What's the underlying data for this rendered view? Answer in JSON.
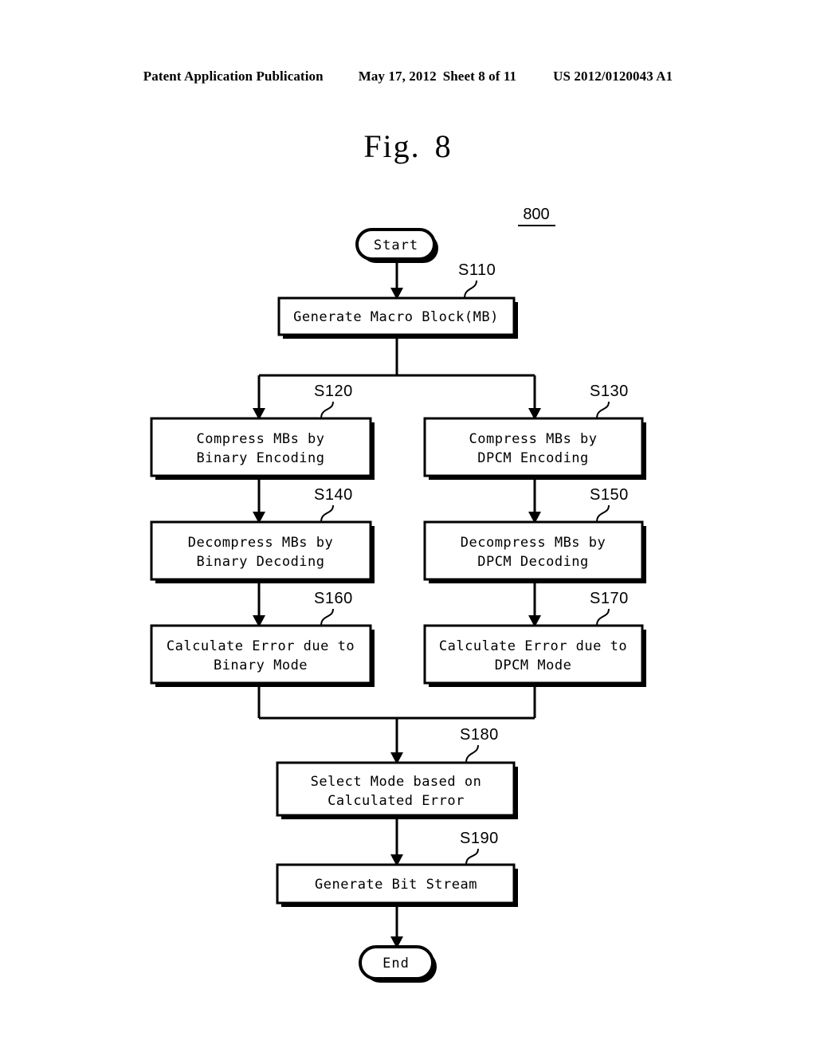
{
  "header": {
    "publication": "Patent Application Publication",
    "date": "May 17, 2012",
    "sheet": "Sheet 8 of 11",
    "publication_number": "US 2012/0120043 A1"
  },
  "figure": {
    "label": "Fig.",
    "number": "8",
    "reference_numeral": "800"
  },
  "flowchart": {
    "start_label": "Start",
    "end_label": "End",
    "nodes": [
      {
        "id": "s110",
        "step": "S110",
        "lines": [
          "Generate Macro Block(MB)"
        ]
      },
      {
        "id": "s120",
        "step": "S120",
        "lines": [
          "Compress MBs by",
          "Binary Encoding"
        ]
      },
      {
        "id": "s130",
        "step": "S130",
        "lines": [
          "Compress MBs by",
          "DPCM Encoding"
        ]
      },
      {
        "id": "s140",
        "step": "S140",
        "lines": [
          "Decompress MBs by",
          "Binary Decoding"
        ]
      },
      {
        "id": "s150",
        "step": "S150",
        "lines": [
          "Decompress MBs by",
          "DPCM Decoding"
        ]
      },
      {
        "id": "s160",
        "step": "S160",
        "lines": [
          "Calculate Error due to",
          "Binary Mode"
        ]
      },
      {
        "id": "s170",
        "step": "S170",
        "lines": [
          "Calculate Error due to",
          "DPCM Mode"
        ]
      },
      {
        "id": "s180",
        "step": "S180",
        "lines": [
          "Select Mode based on",
          "Calculated Error"
        ]
      },
      {
        "id": "s190",
        "step": "S190",
        "lines": [
          "Generate Bit Stream"
        ]
      }
    ]
  },
  "colors": {
    "ink": "#000000",
    "paper": "#ffffff"
  }
}
